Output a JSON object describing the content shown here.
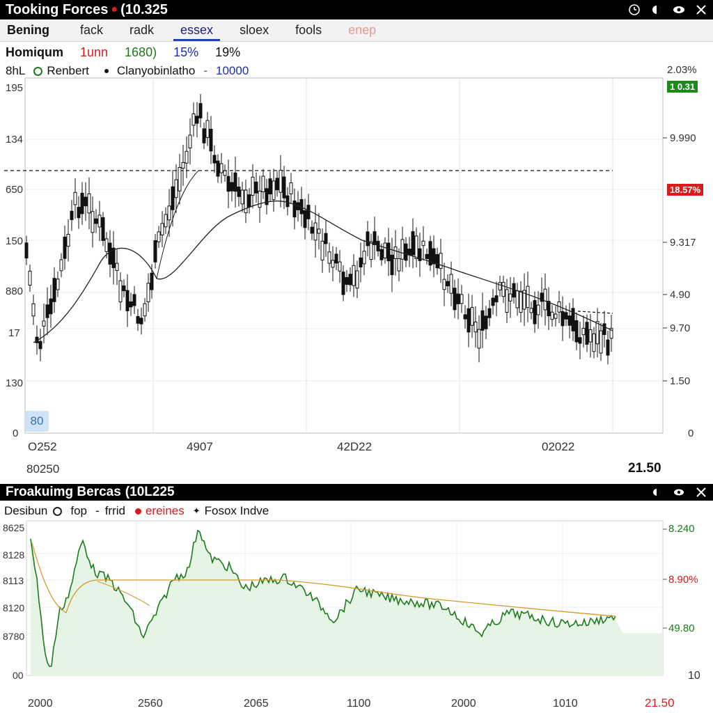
{
  "window": {
    "title": "Tooking Forces",
    "title_suffix": "(10.325"
  },
  "tabs": [
    {
      "label": "Bening",
      "state": "bold"
    },
    {
      "label": "fack",
      "state": "normal"
    },
    {
      "label": "radk",
      "state": "normal"
    },
    {
      "label": "essex",
      "state": "active"
    },
    {
      "label": "sloex",
      "state": "normal"
    },
    {
      "label": "fools",
      "state": "normal"
    },
    {
      "label": "enep",
      "state": "disabled"
    }
  ],
  "stats": {
    "name": "Homiqum",
    "v1": "1unn",
    "v2": "1680)",
    "v3": "15%",
    "v4": "19%"
  },
  "main_chart": {
    "legend": {
      "prefix": "8hL",
      "item1": "Renbert",
      "item2": "Clanyobinlatho",
      "item2_dash": "-",
      "item2_value": "10000"
    },
    "right_top_label": "2.03%",
    "badge_green": "1 0.31",
    "badge_red": "18.57%",
    "left_ticks": [
      "195",
      "134",
      "650",
      "150",
      "880",
      "17",
      "130",
      "0"
    ],
    "right_ticks": [
      "9.990",
      "9.317",
      "4.90",
      "9.70",
      "1.50",
      "0"
    ],
    "x_ticks": [
      "O252",
      "4907",
      "42D22",
      "02022"
    ],
    "bottom_left": "80250",
    "bottom_right": "21.50",
    "corner_box": "80"
  },
  "lower_chart": {
    "title": "Froakuimg Bercas",
    "title_suffix": "(10L225",
    "legend": {
      "item1": "Desibun",
      "item2": "fop",
      "item2_dash": "-",
      "item3": "frrid",
      "item4": "ereines",
      "item5": "Fosox Indve"
    },
    "left_ticks": [
      "8625",
      "8128",
      "8113",
      "8120",
      "8780",
      "00"
    ],
    "right_ticks": [
      "8.240",
      "8.90%",
      "49.80",
      "10"
    ],
    "x_ticks": [
      "2000",
      "2560",
      "2065",
      "1100",
      "2000",
      "1010"
    ],
    "bottom_right": "21.50"
  },
  "colors": {
    "red": "#d61c1c",
    "green": "#1b7a1b",
    "blue": "#1a2fb0",
    "area_fill": "#e6f4e6",
    "ma_orange": "#d39a2a"
  }
}
